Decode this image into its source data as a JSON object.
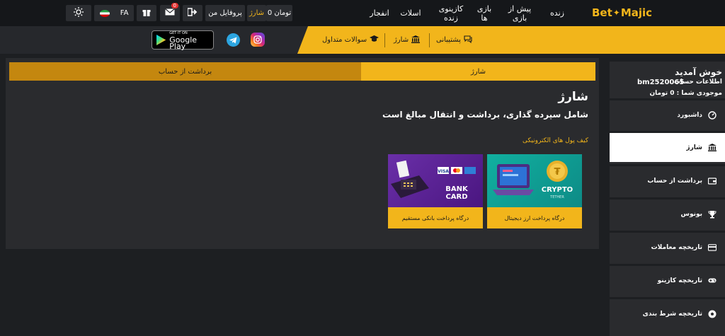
{
  "logo": {
    "part1": "Bet",
    "part2": "Majic"
  },
  "topnav": {
    "items": [
      {
        "label": "زنده"
      },
      {
        "label": "پیش از بازی"
      },
      {
        "label": "بازی ها"
      },
      {
        "label": "کازینوی زنده"
      },
      {
        "label": "اسلات"
      },
      {
        "label": "انفجار"
      }
    ],
    "balance": "0 تومان",
    "charge": "شارژ",
    "profile": "پروفایل من",
    "messages_badge": "0",
    "language": "FA"
  },
  "subbar": {
    "support": "پشتیبانی",
    "charge": "شارژ",
    "faq": "سوالات متداول",
    "gplay_small": "GET IT ON",
    "gplay_big": "Google Play"
  },
  "tabs": {
    "charge": "شارژ",
    "withdraw": "برداشت از حساب"
  },
  "main": {
    "heading": "شارژ",
    "subheading": "شامل سپرده گذاری، برداشت و انتقال مبالغ است",
    "section": "کیف پول های الکترونیکی"
  },
  "cards": {
    "crypto": {
      "footer": "درگاه پرداخت ارز دیجیتال",
      "title": "CRYPTO",
      "subtitle": "TETHER"
    },
    "bank": {
      "footer": "درگاه پرداخت بانکی مستقیم",
      "title": "BANK CARD"
    }
  },
  "sidebar": {
    "welcome": "خوش آمدید",
    "account_label": "اطلاعات حساب :",
    "account_id": "bm2520065",
    "balance": "موجودی شما : 0 تومان",
    "items": [
      {
        "label": "داشبورد"
      },
      {
        "label": "شارژ"
      },
      {
        "label": "برداشت از حساب"
      },
      {
        "label": "بونوس"
      },
      {
        "label": "تاریخچه معاملات"
      },
      {
        "label": "تاریخچه کازینو"
      },
      {
        "label": "تاریخچه شرط بندی"
      }
    ]
  }
}
